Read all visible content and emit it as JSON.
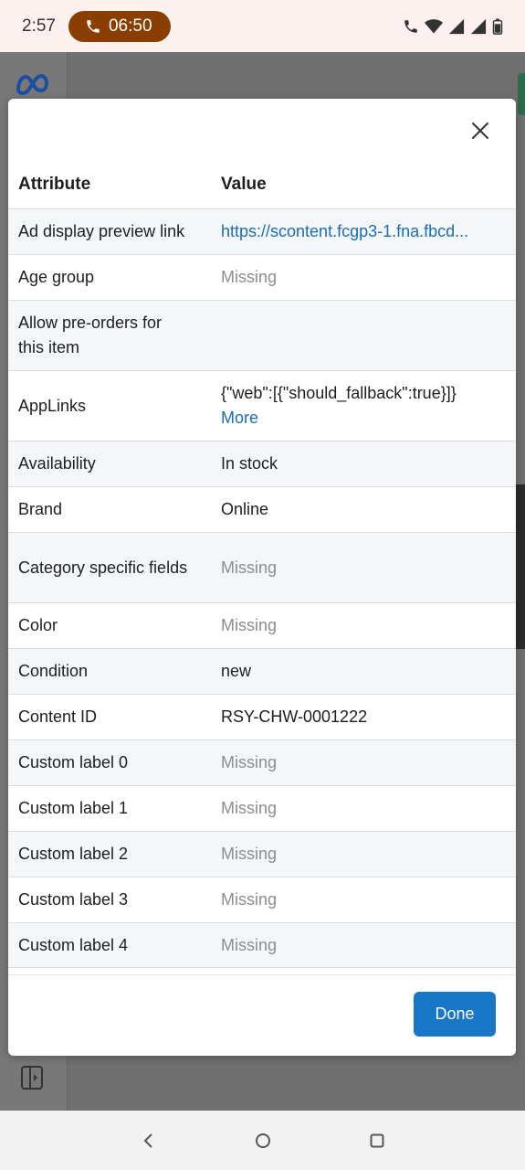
{
  "status_bar": {
    "time": "2:57",
    "call_timer": "06:50"
  },
  "modal": {
    "close_icon": "close-icon",
    "headers": {
      "attribute": "Attribute",
      "value": "Value"
    },
    "rows": [
      {
        "attribute": "Ad display preview link",
        "value": "https://scontent.fcgp3-1.fna.fbcd...",
        "type": "link"
      },
      {
        "attribute": "Age group",
        "value": "Missing",
        "type": "missing"
      },
      {
        "attribute": "Allow pre-orders for this item",
        "value": "",
        "type": "normal"
      },
      {
        "attribute": "AppLinks",
        "value": "{\"web\":[{\"should_fallback\":true}]}",
        "more": "More",
        "type": "normal"
      },
      {
        "attribute": "Availability",
        "value": "In stock",
        "type": "normal"
      },
      {
        "attribute": "Brand",
        "value": "Online",
        "type": "normal"
      },
      {
        "attribute": "Category specific fields",
        "value": "Missing",
        "type": "missing"
      },
      {
        "attribute": "Color",
        "value": "Missing",
        "type": "missing"
      },
      {
        "attribute": "Condition",
        "value": "new",
        "type": "normal"
      },
      {
        "attribute": "Content ID",
        "value": "RSY-CHW-0001222",
        "type": "normal"
      },
      {
        "attribute": "Custom label 0",
        "value": "Missing",
        "type": "missing"
      },
      {
        "attribute": "Custom label 1",
        "value": "Missing",
        "type": "missing"
      },
      {
        "attribute": "Custom label 2",
        "value": "Missing",
        "type": "missing"
      },
      {
        "attribute": "Custom label 3",
        "value": "Missing",
        "type": "missing"
      },
      {
        "attribute": "Custom label 4",
        "value": "Missing",
        "type": "missing"
      }
    ],
    "done_label": "Done"
  },
  "colors": {
    "link": "#1a6eb5",
    "missing": "#8a8d91",
    "done_button": "#1877c6",
    "call_pill": "#8a3e00"
  }
}
